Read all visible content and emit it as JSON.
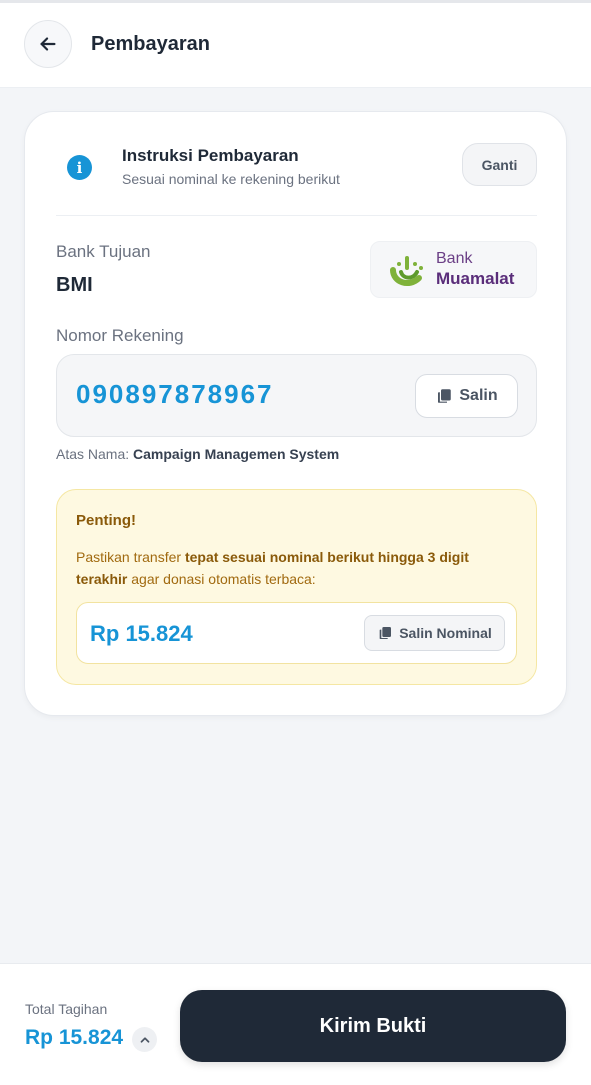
{
  "header": {
    "title": "Pembayaran",
    "back_icon": "arrow-left-icon"
  },
  "instruction": {
    "title": "Instruksi Pembayaran",
    "subtitle": "Sesuai nominal ke rekening berikut",
    "change_label": "Ganti",
    "icon": "info-icon"
  },
  "bank": {
    "label": "Bank Tujuan",
    "value": "BMI",
    "logo_line1": "Bank",
    "logo_line2": "Muamalat"
  },
  "account": {
    "label": "Nomor Rekening",
    "number": "090897878967",
    "copy_label": "Salin",
    "holder_prefix": "Atas Nama:",
    "holder_name": "Campaign Managemen System"
  },
  "alert": {
    "title": "Penting!",
    "text_before": "Pastikan transfer ",
    "text_bold": "tepat sesuai nominal berikut hingga 3 digit terakhir",
    "text_after": " agar donasi otomatis terbaca:",
    "amount": "Rp 15.824",
    "copy_label": "Salin Nominal"
  },
  "footer": {
    "total_label": "Total Tagihan",
    "total_value": "Rp 15.824",
    "submit_label": "Kirim Bukti"
  },
  "colors": {
    "accent": "#1794d6",
    "dark": "#1f2937",
    "alert_bg": "#fef9e1",
    "alert_text": "#8a5a0a"
  }
}
